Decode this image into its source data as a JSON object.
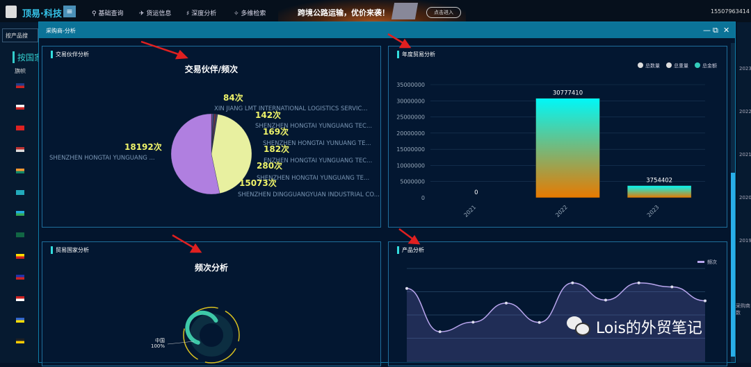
{
  "topbar": {
    "brand": "顶易·科技",
    "menu": [
      "基础查询",
      "货运信息",
      "深度分析",
      "多维检索"
    ],
    "banner_text": "跨境公路运输，优价来袭！",
    "banner_button": "点击进入",
    "phone": "15507963414"
  },
  "sidebar": {
    "search_placeholder": "按产品搜",
    "title": "按国家",
    "flag_header": "旗帜",
    "flags": [
      "uk",
      "russia",
      "vietnam",
      "usa",
      "india",
      "kazakhstan",
      "uzbekistan",
      "pakistan",
      "ecuador",
      "philippines",
      "peru",
      "ukraine",
      "uganda"
    ]
  },
  "right_col": {
    "years": [
      "2023",
      "2022",
      "2021",
      "2020",
      "2019"
    ],
    "label": "采购商数"
  },
  "modal": {
    "title": "采购商-分析",
    "controls": [
      "—",
      "⧉",
      "✕"
    ]
  },
  "panels": {
    "partner": "交易伙伴分析",
    "annual": "年度贸易分析",
    "country": "贸易国家分析",
    "product": "产品分析"
  },
  "chart_data": [
    {
      "type": "pie",
      "title": "交易伙伴/频次",
      "slices": [
        {
          "label": "XIN JIANG LMT INTERNATIONAL LOGISTICS SERVIC...",
          "value": 84,
          "value_label": "84次",
          "color": "#d04070"
        },
        {
          "label": "SHENZHEN HONGTAI YUNGUANG TEC...",
          "value": 142,
          "value_label": "142次",
          "color": "#6a4fa0"
        },
        {
          "label": "SHENZHEN HONGTAI YUNUANG TE...",
          "value": 169,
          "value_label": "169次",
          "color": "#305070"
        },
        {
          "label": "ENZHEN HONGTAI YUNGUANG TEC...",
          "value": 182,
          "value_label": "182次",
          "color": "#8a3040"
        },
        {
          "label": "SHENZHEN HONGTAI YUNGUANG TE...",
          "value": 280,
          "value_label": "280次",
          "color": "#404060"
        },
        {
          "label": "SHENZHEN DINGGUANGYUAN INDUSTRIAL CO...",
          "value": 15073,
          "value_label": "15073次",
          "color": "#e8f0a0"
        },
        {
          "label": "SHENZHEN HONGTAI YUNGUANG ...",
          "value": 18192,
          "value_label": "18192次",
          "color": "#b07fe0"
        }
      ]
    },
    {
      "type": "bar",
      "title": "",
      "legend": [
        "总数量",
        "总重量",
        "总金额"
      ],
      "categories": [
        "2021",
        "2022",
        "2023"
      ],
      "values": [
        0,
        30777410,
        3754402
      ],
      "value_labels": [
        "0",
        "30777410",
        "3754402"
      ],
      "yticks": [
        "0",
        "5000000",
        "10000000",
        "15000000",
        "20000000",
        "25000000",
        "30000000",
        "35000000"
      ],
      "ylim": [
        0,
        35000000
      ]
    },
    {
      "type": "pie",
      "title": "频次分析",
      "slices": [
        {
          "label": "中国",
          "value_label": "100%",
          "value": 100,
          "color": "#3ec8a8"
        }
      ]
    },
    {
      "type": "area",
      "legend": [
        "频次"
      ],
      "values": [
        314,
        128,
        169,
        251,
        168,
        338,
        264,
        338,
        321,
        261
      ],
      "ylim": [
        0,
        400
      ],
      "color": "#b9a6ee"
    }
  ],
  "watermark": "Lois的外贸笔记"
}
